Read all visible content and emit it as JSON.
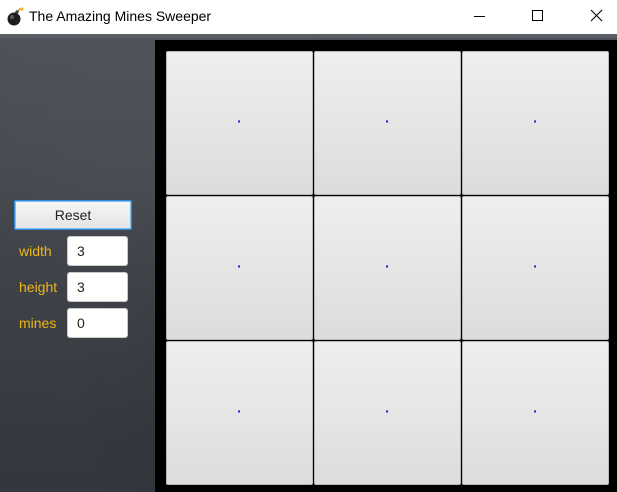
{
  "window": {
    "title": "The Amazing Mines Sweeper",
    "icon": "bomb-icon",
    "controls": [
      "minimize-icon",
      "maximize-icon",
      "close-icon"
    ]
  },
  "sidebar": {
    "reset_label": "Reset",
    "fields": [
      {
        "label": "width",
        "value": "3"
      },
      {
        "label": "height",
        "value": "3"
      },
      {
        "label": "mines",
        "value": "0"
      }
    ]
  },
  "board": {
    "rows": 3,
    "cols": 3,
    "cells": [
      [
        "·",
        "·",
        "·"
      ],
      [
        "·",
        "·",
        "·"
      ],
      [
        "·",
        "·",
        "·"
      ]
    ]
  },
  "colors": {
    "label": "#f0b414",
    "cell_mark": "#1a1adf",
    "focus_border": "#2e8ad8",
    "board_bg": "#000000"
  }
}
